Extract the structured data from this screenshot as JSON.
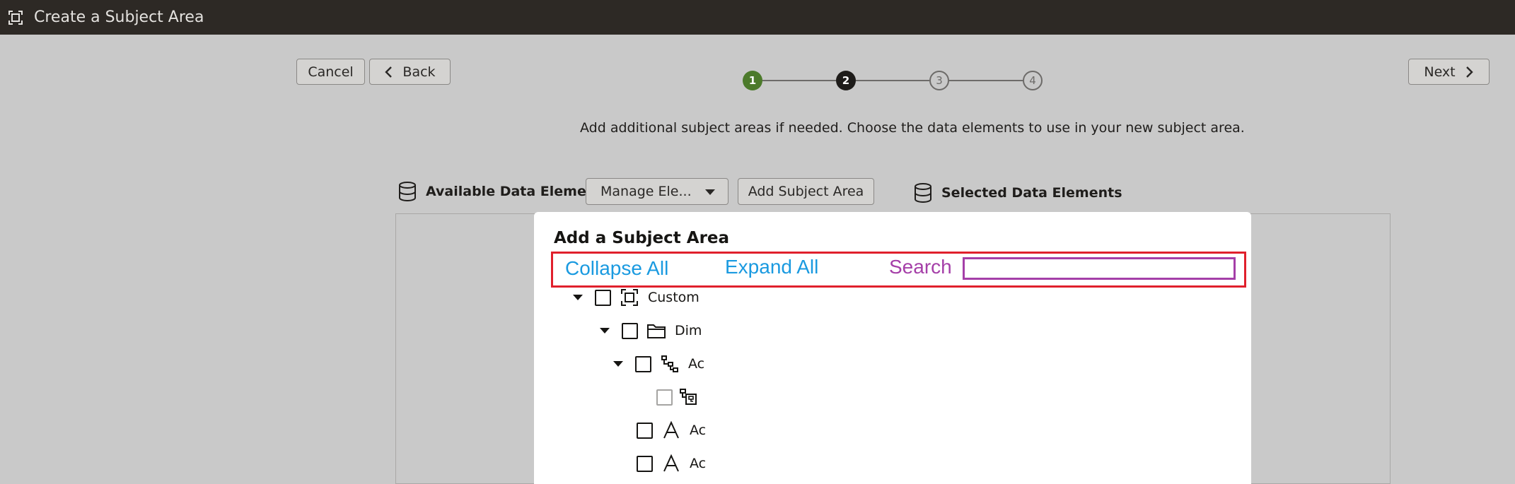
{
  "window": {
    "title": "Create a Subject Area",
    "icon": "subject-area-icon"
  },
  "toolbar": {
    "cancel_label": "Cancel",
    "back_label": "Back",
    "next_label": "Next"
  },
  "stepper": {
    "current": 2,
    "steps": [
      {
        "label": "1",
        "state": "done"
      },
      {
        "label": "2",
        "state": "active"
      },
      {
        "label": "3",
        "state": "todo"
      },
      {
        "label": "4",
        "state": "todo"
      }
    ]
  },
  "instruction": "Add additional subject areas if needed. Choose the data elements to use in your new subject area.",
  "available_panel": {
    "label": "Available Data Elements",
    "manage_label": "Manage Ele...",
    "add_subject_area_label": "Add Subject Area"
  },
  "selected_panel": {
    "label": "Selected Data Elements"
  },
  "dialog": {
    "title": "Add a Subject Area",
    "collapse_all": "Collapse All",
    "expand_all": "Expand All",
    "search_label": "Search",
    "search_value": "",
    "tree": [
      {
        "label": "Custom",
        "icon": "subject-area-icon",
        "expanded": true
      },
      {
        "label": "Dim -",
        "icon": "folder-icon",
        "expanded": true
      },
      {
        "label": "Ac",
        "icon": "hierarchy-icon",
        "expanded": true
      },
      {
        "label": "",
        "icon": "hierarchy-level-icon",
        "expanded": false
      },
      {
        "label": "Ac",
        "icon": "attribute-icon",
        "expanded": false
      },
      {
        "label": "Ac",
        "icon": "attribute-icon",
        "expanded": false
      }
    ]
  },
  "colors": {
    "titlebar": "#2d2925",
    "step_done": "#4c7a2b",
    "step_active": "#1e1c1a",
    "link_blue": "#1a9ae0",
    "search_purple": "#a53fa8",
    "highlight_red": "#e0202c"
  }
}
